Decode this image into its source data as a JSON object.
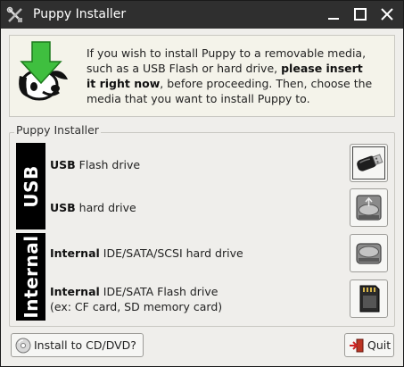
{
  "window": {
    "title": "Puppy Installer",
    "icon": "tools-icon",
    "controls": [
      "minimize-icon",
      "maximize-icon",
      "close-icon"
    ]
  },
  "header": {
    "line1": "If you wish to install Puppy to a removable media,",
    "line2_pre": "such as a USB Flash or hard drive, ",
    "line2_bold": "please insert",
    "line3_bold": "it right now",
    "line3_post": ", before proceeding. Then, choose the",
    "line4": "media that you want to install Puppy to."
  },
  "frame_label": "Puppy Installer",
  "groups": {
    "usb": "USB",
    "internal": "Internal"
  },
  "items": [
    {
      "bold": "USB",
      "rest": " Flash drive",
      "rest2": "",
      "icon": "usb-flash-drive-icon"
    },
    {
      "bold": "USB",
      "rest": " hard drive",
      "rest2": "",
      "icon": "usb-hard-drive-icon"
    },
    {
      "bold": "Internal",
      "rest": " IDE/SATA/SCSI hard drive",
      "rest2": "",
      "icon": "internal-hard-drive-icon"
    },
    {
      "bold": "Internal",
      "rest": " IDE/SATA Flash drive",
      "rest2": "(ex: CF card, SD memory card)",
      "icon": "memory-card-icon"
    }
  ],
  "buttons": {
    "cd": "Install to CD/DVD?",
    "quit": "Quit"
  },
  "colors": {
    "titlebar": "#2f2f2f",
    "window_bg": "#efeeeb",
    "side_bars": "#000000",
    "logo_green": "#3fbf3f"
  }
}
